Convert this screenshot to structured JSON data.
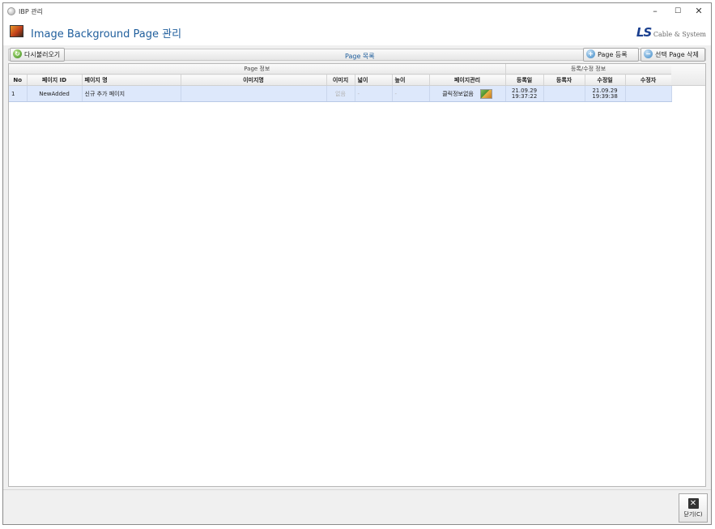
{
  "window": {
    "title": "IBP 관리",
    "minimize": "–",
    "maximize": "☐",
    "close": "✕"
  },
  "header": {
    "title": "Image Background Page 관리",
    "logo_ls": "LS",
    "logo_text": "Cable & System"
  },
  "toolbar": {
    "reload": "다시불러오기",
    "list_title": "Page 목록",
    "add": "Page 등록",
    "delete": "선택 Page 삭제",
    "add_icon": "plus-circle-icon",
    "delete_icon": "minus-circle-icon",
    "reload_icon": "refresh-icon"
  },
  "table": {
    "groups": {
      "page_info": "Page 정보",
      "reg_info": "등록/수정 정보"
    },
    "columns": {
      "no": "No",
      "page_id": "페이지 ID",
      "page_name": "페이지 명",
      "image_name": "이미지명",
      "image": "이미지",
      "width": "넓이",
      "height": "높이",
      "page_mgmt": "페이지관리",
      "reg_date": "등록일",
      "registrant": "등록자",
      "mod_date": "수정일",
      "modifier": "수정자"
    },
    "rows": [
      {
        "no": "1",
        "page_id": "NewAdded",
        "page_name": "신규 추가 페이지",
        "image_name": "",
        "image": "없음",
        "width": "-",
        "height": "-",
        "page_mgmt": "클릭정보없음",
        "reg_date": "21.09.29",
        "reg_time": "19:37:22",
        "registrant": "",
        "mod_date": "21.09.29",
        "mod_time": "19:39:38",
        "modifier": ""
      }
    ]
  },
  "footer": {
    "close": "닫기(C)",
    "close_icon": "close-x-icon"
  }
}
